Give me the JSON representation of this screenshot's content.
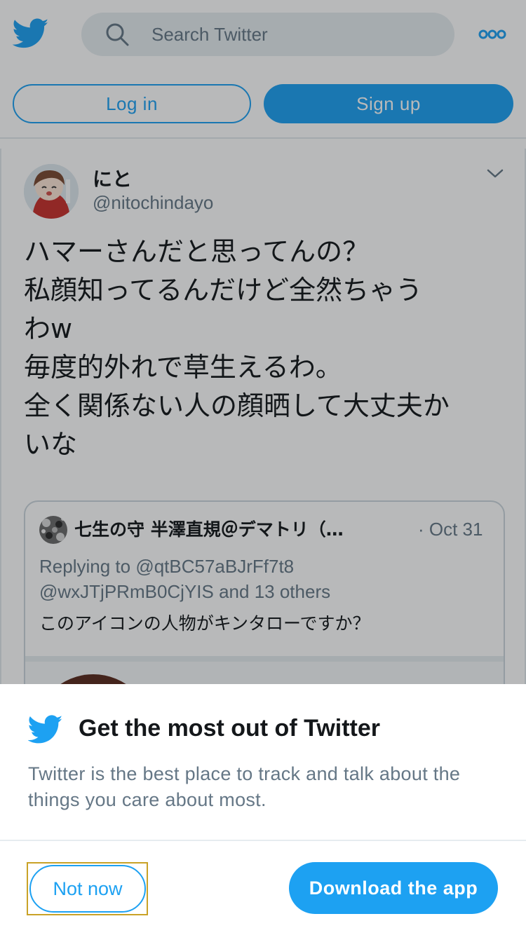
{
  "colors": {
    "accent": "#1da1f2",
    "secondary_text": "#657786",
    "primary_text": "#14171a"
  },
  "header": {
    "logo_icon": "twitter-bird-icon",
    "search_placeholder": "Search Twitter",
    "search_icon": "search-icon",
    "more_icon": "more-dots-icon",
    "login_label": "Log in",
    "signup_label": "Sign up"
  },
  "tweet": {
    "display_name": "にと",
    "handle": "@nitochindayo",
    "menu_icon": "chevron-down-icon",
    "lines": [
      "ハマーさんだと思ってんの？",
      "私顔知ってるんだけど全然ちゃう",
      "わw",
      "毎度的外れで草生えるわ。",
      "全く関係ない人の顔晒して大丈夫か",
      "いな"
    ],
    "quote": {
      "name": "七生の守 半澤直規＠デマトリ（当...",
      "date": "· Oct 31",
      "replying_prefix": "Replying to",
      "replying_line1": "@qtBC57aBJrFf7t8",
      "replying_line2": "@wxJTjPRmB0CjYIS and 13 others",
      "text": "このアイコンの人物がキンタローですか？"
    }
  },
  "sheet": {
    "logo_icon": "twitter-bird-icon",
    "title": "Get the most out of Twitter",
    "description": "Twitter is the best place to track and talk about the things you care about most.",
    "not_now_label": "Not now",
    "download_label": "Download the app"
  }
}
